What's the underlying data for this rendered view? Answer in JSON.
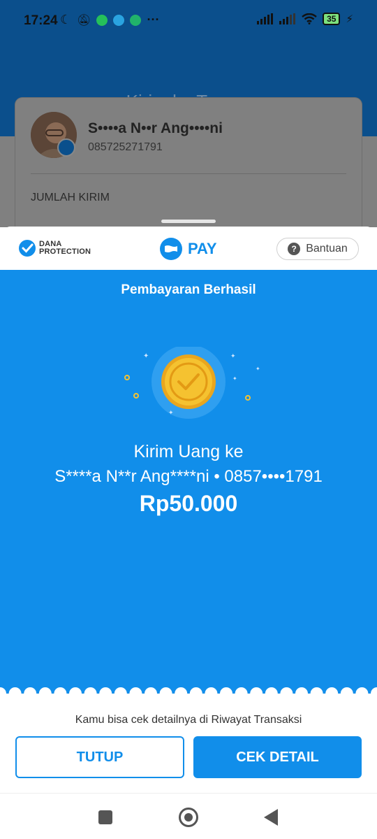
{
  "status_bar": {
    "time": "17:24",
    "battery": "35"
  },
  "header": {
    "title": "Kirim ke Teman"
  },
  "recipient": {
    "name": "S••••a N••r Ang••••ni",
    "phone": "085725271791",
    "amount_label": "JUMLAH KIRIM"
  },
  "sheet": {
    "protection_line1": "DANA",
    "protection_line2": "PROTECTION",
    "pay_label": "PAY",
    "help_label": "Bantuan",
    "help_icon": "?"
  },
  "success": {
    "title": "Pembayaran Berhasil",
    "transfer_title": "Kirim Uang ke",
    "transfer_recipient": "S****a N**r Ang****ni • 0857••••1791",
    "amount": "Rp50.000"
  },
  "footer": {
    "hint": "Kamu bisa cek detailnya di Riwayat Transaksi",
    "close_label": "TUTUP",
    "detail_label": "CEK DETAIL"
  },
  "colors": {
    "brand_blue": "#118eea",
    "header_blue": "#0b4f8c",
    "coin_gold": "#f5c230"
  }
}
